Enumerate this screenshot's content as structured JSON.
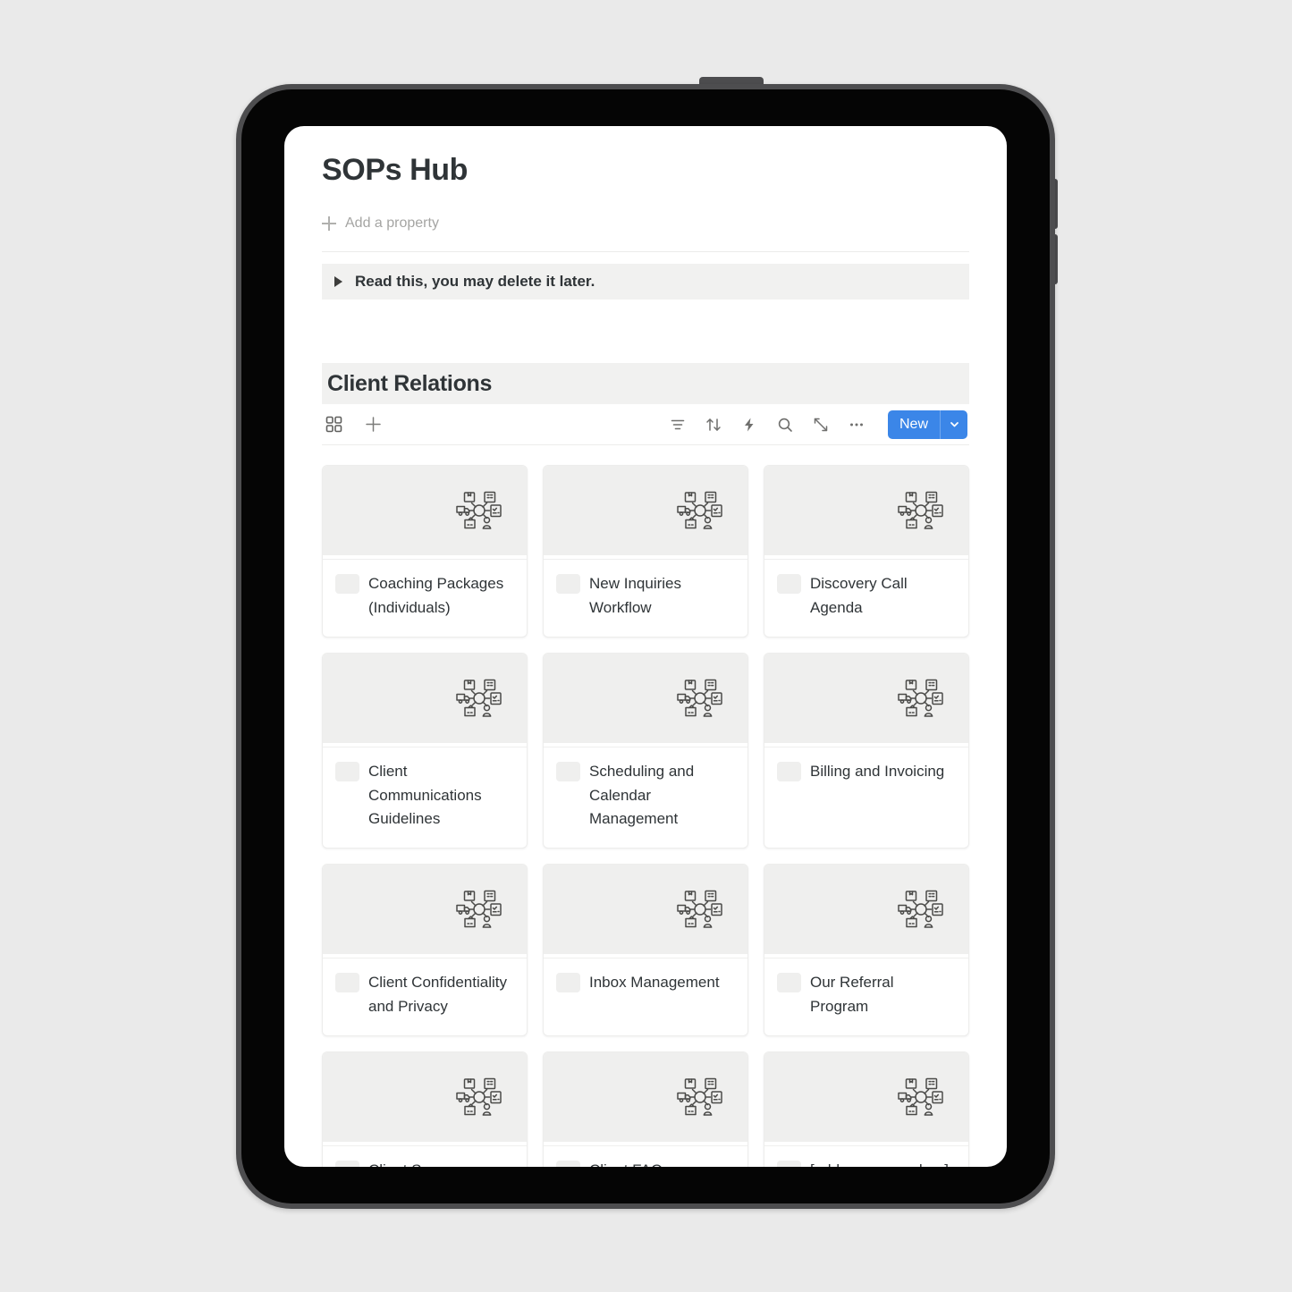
{
  "device": {
    "sensors": [
      "proximity-sensor",
      "front-camera",
      "indicator-light"
    ],
    "buttons": [
      "power-button",
      "volume-up-button",
      "volume-down-button"
    ]
  },
  "page": {
    "title": "SOPs Hub",
    "add_property_label": "Add a property",
    "toggle_block_text": "Read this, you may delete it later."
  },
  "section": {
    "title": "Client Relations"
  },
  "toolbar": {
    "left_icons": [
      {
        "name": "gallery-view-icon",
        "label": "Gallery view"
      },
      {
        "name": "add-view-icon",
        "label": "Add a view"
      }
    ],
    "right_icons": [
      {
        "name": "filter-icon",
        "label": "Filter"
      },
      {
        "name": "sort-icon",
        "label": "Sort"
      },
      {
        "name": "automation-icon",
        "label": "Automations"
      },
      {
        "name": "search-icon",
        "label": "Search"
      },
      {
        "name": "expand-icon",
        "label": "Open as full page"
      },
      {
        "name": "more-options-icon",
        "label": "More options"
      }
    ],
    "new_label": "New",
    "new_caret": "chevron-down-icon",
    "accent_color": "#3b86e8"
  },
  "colors": {
    "page_background": "#eaeaea",
    "device_rim": "#4d4d4f",
    "bezel": "#050505",
    "screen": "#ffffff",
    "block_gray": "#f1f1f0",
    "card_cover": "#efefee",
    "text_primary": "#2f3437",
    "text_muted": "#a5a5a3",
    "accent_blue": "#3b86e8"
  },
  "gallery": {
    "card_icon_name": "supply-chain-network-icon",
    "cards": [
      {
        "title": "Coaching Packages (Individuals)"
      },
      {
        "title": "New Inquiries Workflow"
      },
      {
        "title": "Discovery Call Agenda"
      },
      {
        "title": "Client Communications Guidelines"
      },
      {
        "title": "Scheduling and Calendar Management"
      },
      {
        "title": "Billing and Invoicing"
      },
      {
        "title": "Client Confidentiality and Privacy"
      },
      {
        "title": "Inbox Management"
      },
      {
        "title": "Our Referral Program"
      },
      {
        "title": "Client Success"
      },
      {
        "title": "Client FAQs"
      },
      {
        "title": "[add new procedure]"
      }
    ]
  }
}
